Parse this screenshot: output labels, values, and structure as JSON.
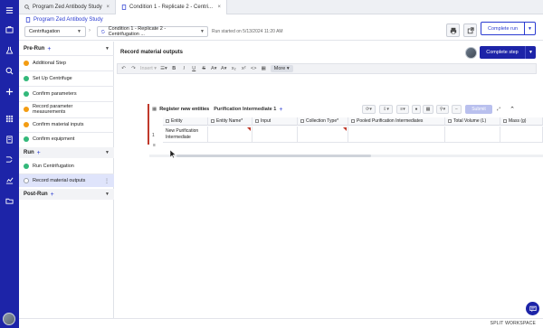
{
  "tabs": [
    {
      "label": "Program Zed Antibody Study",
      "close": "×"
    },
    {
      "label": "Condition 1 - Replicate 2 - Centri...",
      "close": "×"
    }
  ],
  "header": {
    "breadcrumb": "Program Zed Antibody Study",
    "process_select": "Centrifugation",
    "step_select": "Condition 1 - Replicate 2 - Centrifugation ...",
    "run_started": "Run started on 5/13/2024 11:20 AM",
    "complete_run": "Complete run"
  },
  "sidebar": {
    "sections": [
      {
        "label": "Pre-Run"
      },
      {
        "label": "Run"
      },
      {
        "label": "Post-Run"
      }
    ],
    "pre_run_steps": [
      {
        "label": "Additional Step",
        "status": "orange"
      },
      {
        "label": "Set Up Centrifuge",
        "status": "green"
      },
      {
        "label": "Confirm parameters",
        "status": "green"
      },
      {
        "label": "Record parameter measurements",
        "status": "orange"
      },
      {
        "label": "Confirm material inputs",
        "status": "orange"
      },
      {
        "label": "Confirm equipment",
        "status": "green"
      }
    ],
    "run_steps": [
      {
        "label": "Run Centrifugation",
        "status": "green"
      },
      {
        "label": "Record material outputs",
        "status": "empty",
        "selected": true
      }
    ]
  },
  "main": {
    "title": "Record material outputs",
    "complete_step": "Complete step",
    "toolbar": {
      "insert": "Insert",
      "more": "More"
    }
  },
  "entity_block": {
    "title": "Register new entities",
    "type": "Purification Intermediate 1",
    "submit": "Submit",
    "columns": [
      "Entity",
      "Entity Name*",
      "Input",
      "Collection Type*",
      "Pooled Purification Intermediates",
      "Total Volume (L)",
      "Mass (g)"
    ],
    "rows": [
      {
        "num": "1",
        "entity": "New Purification Intermediate",
        "name": "",
        "input": "",
        "collection": "",
        "pooled": "",
        "volume": "",
        "mass": ""
      }
    ]
  },
  "footer": {
    "workspace": "SPLIT WORKSPACE"
  },
  "colors": {
    "brand": "#1d24a8",
    "accent": "#2a3bd1",
    "required": "#c0392b"
  }
}
